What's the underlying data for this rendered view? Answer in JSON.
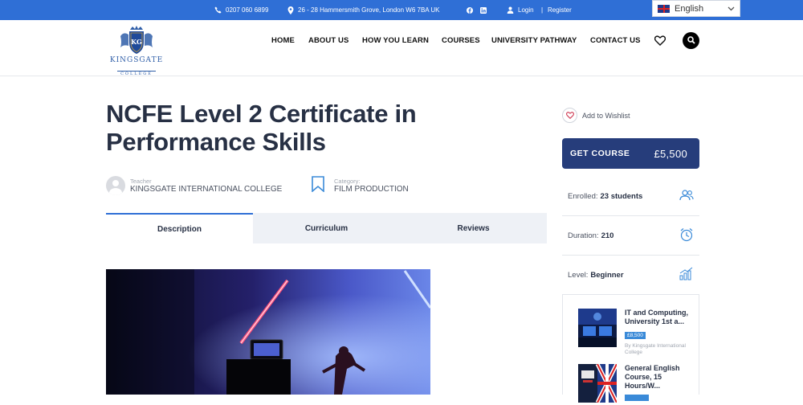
{
  "topbar": {
    "phone": "0207 060 6899",
    "address": "26 - 28 Hammersmith Grove, London W6 7BA UK",
    "login": "Login",
    "separator": "|",
    "register": "Register",
    "language": "English"
  },
  "brand": {
    "name": "KINGSGATE",
    "sub": "COLLEGE",
    "monogram": "KG"
  },
  "nav": [
    {
      "label": "HOME"
    },
    {
      "label": "ABOUT US"
    },
    {
      "label": "HOW YOU LEARN"
    },
    {
      "label": "COURSES"
    },
    {
      "label": "UNIVERSITY PATHWAY"
    },
    {
      "label": "CONTACT US"
    }
  ],
  "course": {
    "title": "NCFE Level 2 Certificate in Performance Skills",
    "teacher_label": "Teacher",
    "teacher": "KINGSGATE INTERNATIONAL COLLEGE",
    "category_label": "Category:",
    "category": "FILM PRODUCTION"
  },
  "tabs": [
    {
      "label": "Description",
      "active": true
    },
    {
      "label": "Curriculum",
      "active": false
    },
    {
      "label": "Reviews",
      "active": false
    }
  ],
  "sidebar": {
    "wishlist": "Add to Wishlist",
    "get_course": "GET COURSE",
    "price": "£5,500",
    "enrolled_label": "Enrolled:",
    "enrolled_value": "23 students",
    "duration_label": "Duration:",
    "duration_value": "210",
    "level_label": "Level:",
    "level_value": "Beginner"
  },
  "related": [
    {
      "title": "IT and Computing, University 1st a...",
      "price": "£8,500",
      "by": "By Kingsgate International College"
    },
    {
      "title": "General English Course, 15 Hours/W...",
      "price": "",
      "by": ""
    }
  ],
  "colors": {
    "topbar": "#2f6fd6",
    "button": "#263d7b",
    "accent_icon": "#3a8ad8"
  }
}
